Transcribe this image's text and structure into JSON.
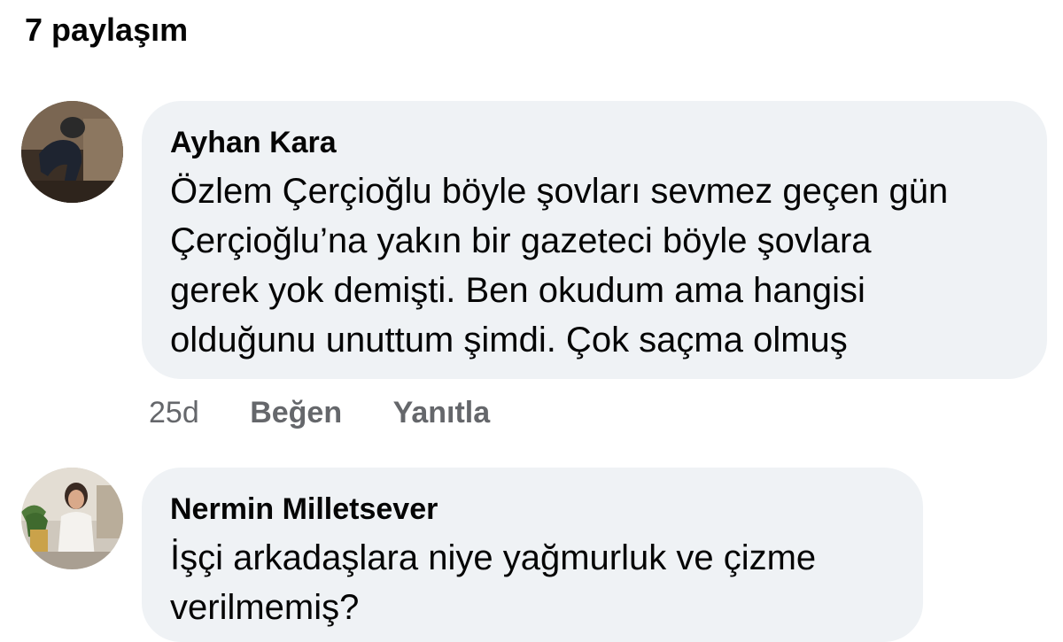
{
  "header": {
    "shares_label": "7 paylaşım"
  },
  "comments": [
    {
      "author": "Ayhan Kara",
      "lines": [
        "Özlem Çerçioğlu böyle şovları sevmez geçen gün",
        "Çerçioğlu’na yakın bir gazeteci böyle şovlara",
        "gerek yok demişti. Ben okudum ama hangisi",
        "olduğunu unuttum şimdi. Çok saçma olmuş"
      ],
      "age": "25d",
      "like_label": "Beğen",
      "reply_label": "Yanıtla"
    },
    {
      "author": "Nermin Milletsever",
      "lines": [
        "İşçi arkadaşlara niye yağmurluk ve çizme",
        "verilmemiş?"
      ]
    }
  ],
  "colors": {
    "bubble_bg": "#eff2f5",
    "text": "#050505",
    "meta_text": "#65676b"
  }
}
